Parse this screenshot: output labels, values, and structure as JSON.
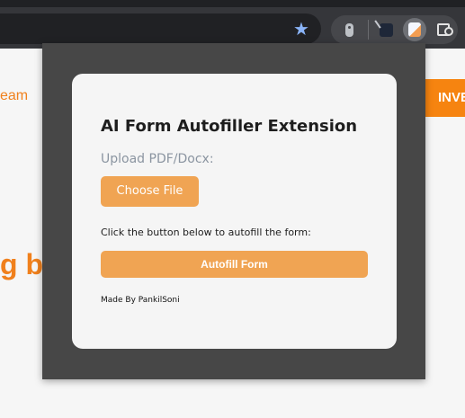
{
  "browser": {
    "bookmark_icon": "star-icon",
    "extensions": [
      "pin-icon",
      "extension-icon",
      "ai-form-autofiller-icon",
      "puzzle-icon"
    ]
  },
  "background_page": {
    "partial_text_top": "eam",
    "partial_heading": "g b",
    "cta_partial": "INVE",
    "accent_color": "#f68410"
  },
  "popup": {
    "title": "AI Form Autofiller Extension",
    "upload_label": "Upload PDF/Docx:",
    "choose_file_label": "Choose File",
    "instruction": "Click the button below to autofill the form:",
    "autofill_label": "Autofill Form",
    "credit": "Made By PankilSoni",
    "button_color": "#f0a453"
  }
}
